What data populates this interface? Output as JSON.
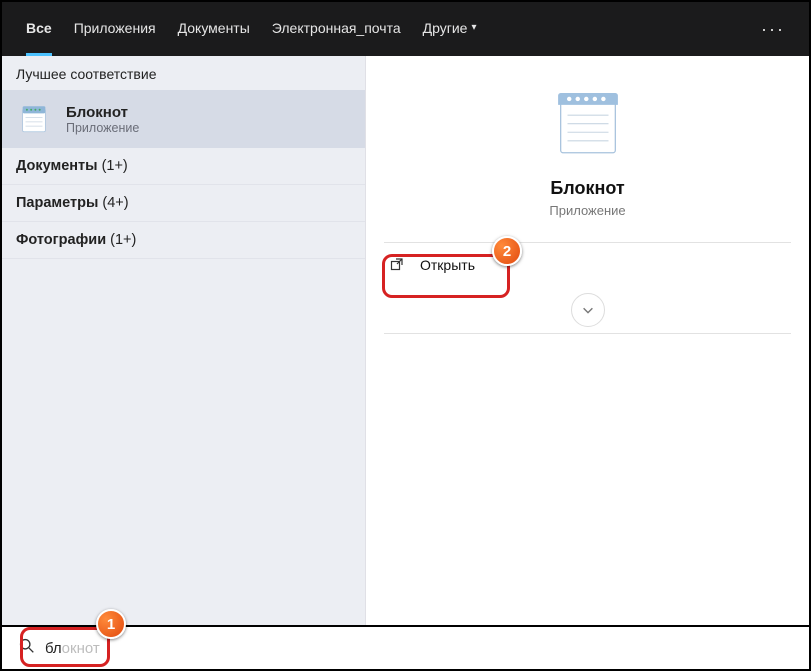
{
  "tabs": {
    "all": "Все",
    "apps": "Приложения",
    "docs": "Документы",
    "email": "Электронная_почта",
    "more": "Другие"
  },
  "left": {
    "best_match": "Лучшее соответствие",
    "result": {
      "title": "Блокнот",
      "sub": "Приложение"
    },
    "cat_docs": "Документы ",
    "cat_docs_count": "(1+)",
    "cat_params": "Параметры ",
    "cat_params_count": "(4+)",
    "cat_photos": "Фотографии ",
    "cat_photos_count": "(1+)"
  },
  "right": {
    "title": "Блокнот",
    "sub": "Приложение",
    "open": "Открыть"
  },
  "search": {
    "typed": "бл",
    "ghost": "окнот"
  },
  "annotations": {
    "one": "1",
    "two": "2"
  }
}
